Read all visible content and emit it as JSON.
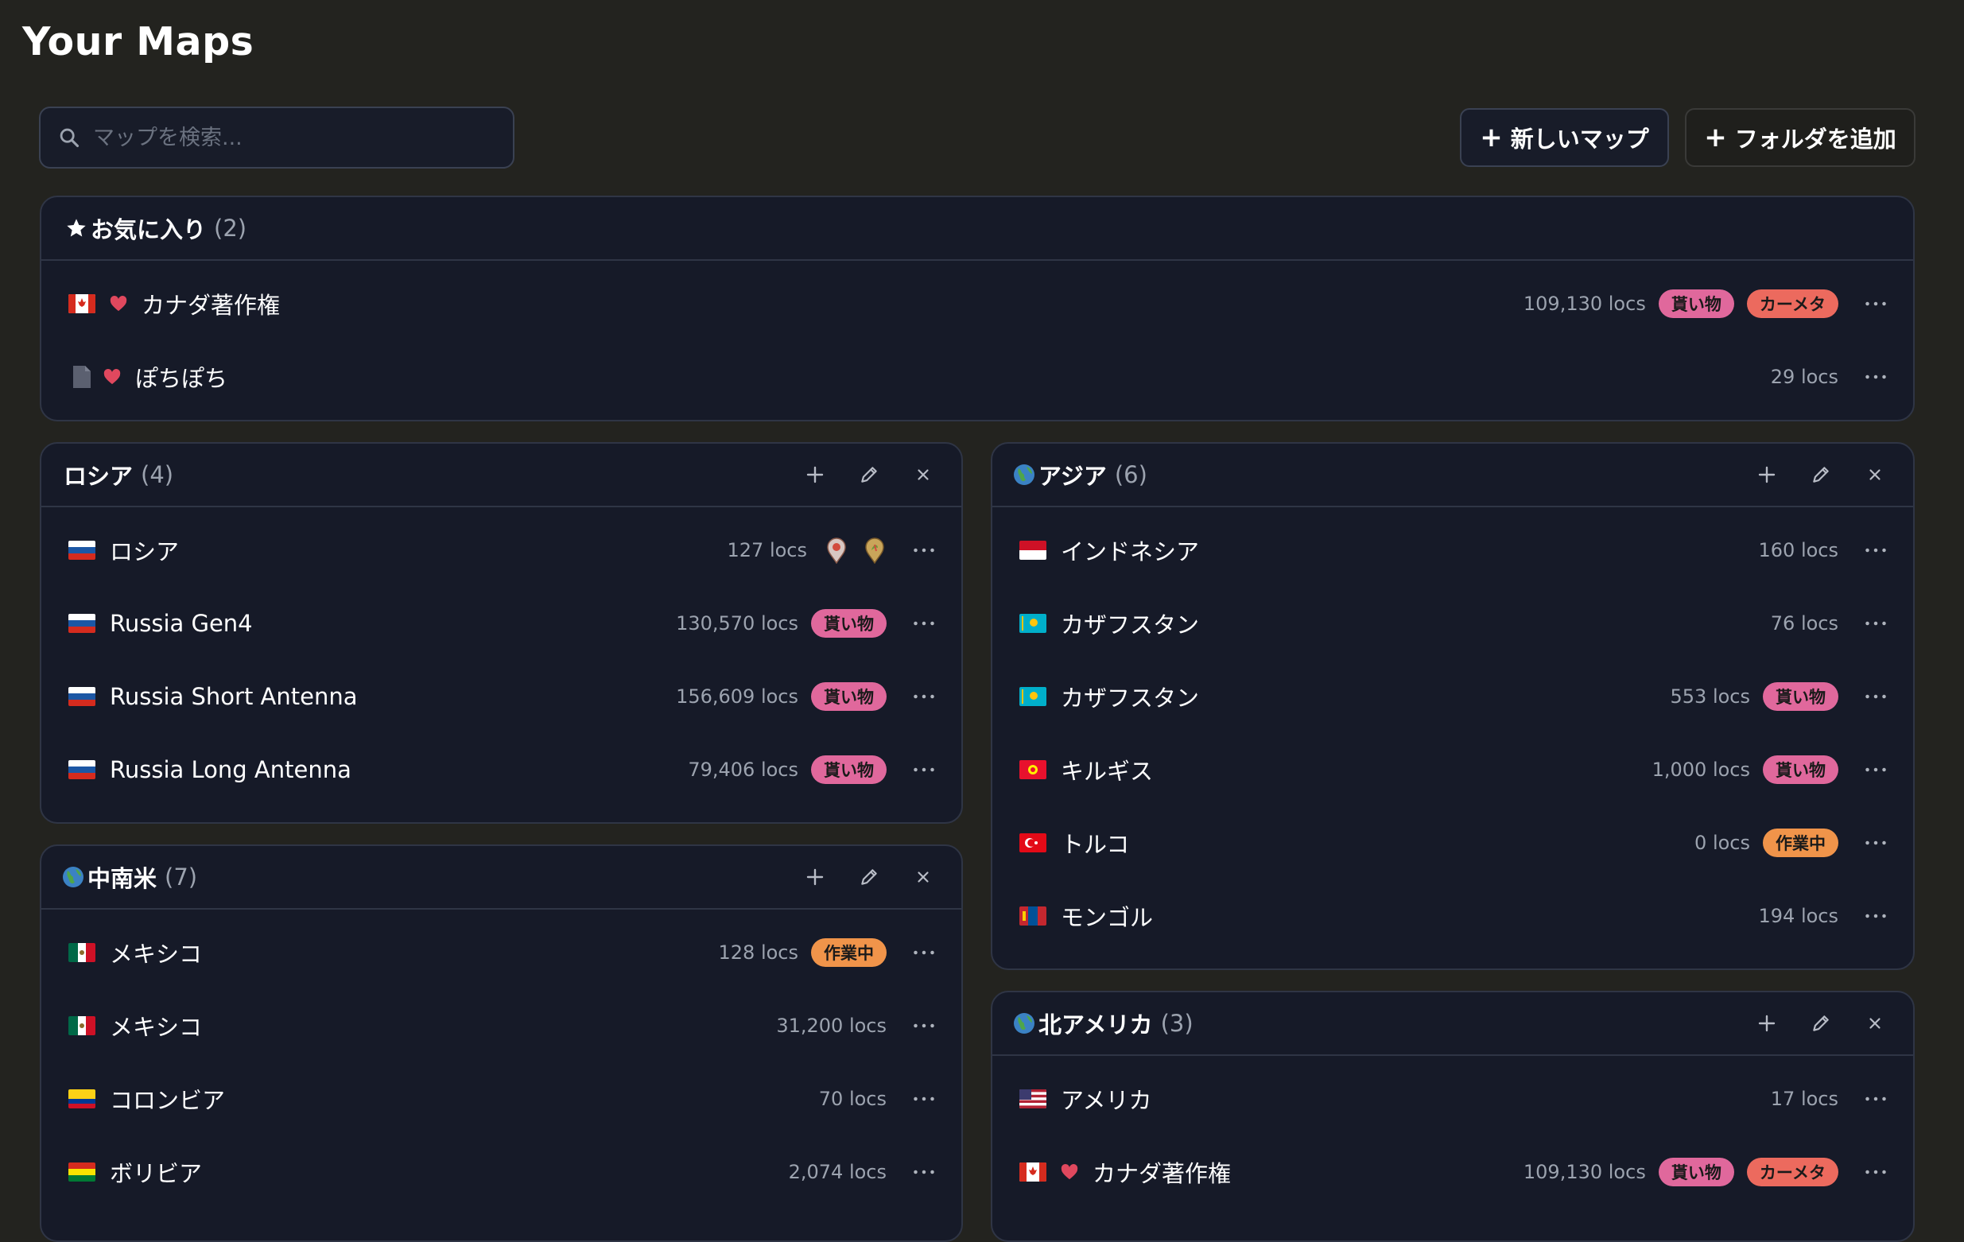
{
  "page_title": "Your Maps",
  "search": {
    "placeholder": "マップを検索..."
  },
  "toolbar": {
    "new_map_label": "新しいマップ",
    "add_folder_label": "フォルダを追加"
  },
  "colors": {
    "background": "#23231f",
    "card": "#161a28",
    "badge_kaimono": "#e0689c",
    "badge_camera": "#ec6a5e",
    "badge_wip": "#f0944a",
    "heart": "#e0485e"
  },
  "favorites": {
    "title": "お気に入り",
    "count": "(2)",
    "items": [
      {
        "flag": "ca",
        "name": "カナダ著作権",
        "locs": "109,130 locs",
        "badges": [
          "貰い物",
          "カーメタ"
        ]
      },
      {
        "icon": "document-icon",
        "name": "ぽちぽち",
        "locs": "29 locs"
      }
    ]
  },
  "folders": {
    "russia": {
      "title": "ロシア",
      "count": "(4)",
      "items": [
        {
          "flag": "ru",
          "name": "ロシア",
          "locs": "127 locs",
          "markers": [
            "map-pin-icon",
            "map-pin-icon"
          ]
        },
        {
          "flag": "ru",
          "name": "Russia Gen4",
          "locs": "130,570 locs",
          "badge": "貰い物"
        },
        {
          "flag": "ru",
          "name": "Russia Short Antenna",
          "locs": "156,609 locs",
          "badge": "貰い物"
        },
        {
          "flag": "ru",
          "name": "Russia Long Antenna",
          "locs": "79,406 locs",
          "badge": "貰い物"
        }
      ]
    },
    "latam": {
      "title": "中南米",
      "count": "(7)",
      "items": [
        {
          "flag": "mx",
          "name": "メキシコ",
          "locs": "128 locs",
          "badge": "作業中"
        },
        {
          "flag": "mx",
          "name": "メキシコ",
          "locs": "31,200 locs"
        },
        {
          "flag": "co",
          "name": "コロンビア",
          "locs": "70 locs"
        },
        {
          "flag": "bo",
          "name": "ボリビア",
          "locs": "2,074 locs"
        }
      ]
    },
    "asia": {
      "title": "アジア",
      "count": "(6)",
      "items": [
        {
          "flag": "id",
          "name": "インドネシア",
          "locs": "160 locs"
        },
        {
          "flag": "kz",
          "name": "カザフスタン",
          "locs": "76 locs"
        },
        {
          "flag": "kz",
          "name": "カザフスタン",
          "locs": "553 locs",
          "badge": "貰い物"
        },
        {
          "flag": "kg",
          "name": "キルギス",
          "locs": "1,000 locs",
          "badge": "貰い物"
        },
        {
          "flag": "tr",
          "name": "トルコ",
          "locs": "0 locs",
          "badge": "作業中"
        },
        {
          "flag": "mn",
          "name": "モンゴル",
          "locs": "194 locs"
        }
      ]
    },
    "north_america": {
      "title": "北アメリカ",
      "count": "(3)",
      "items": [
        {
          "flag": "us",
          "name": "アメリカ",
          "locs": "17 locs"
        },
        {
          "flag": "ca",
          "name": "カナダ著作権",
          "locs": "109,130 locs",
          "badges": [
            "貰い物",
            "カーメタ"
          ]
        }
      ]
    }
  }
}
